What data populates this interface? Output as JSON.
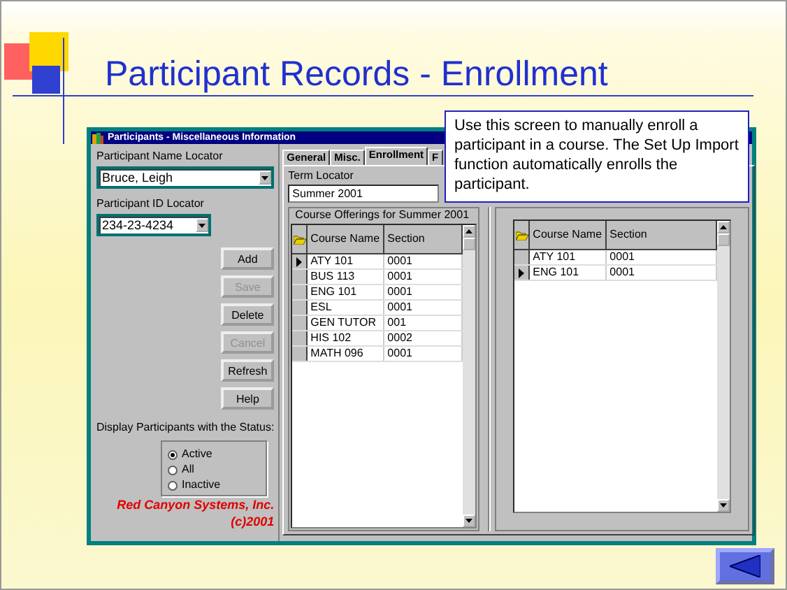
{
  "slide": {
    "title": "Participant Records - Enrollment"
  },
  "window": {
    "title": "Participants - Miscellaneous Information"
  },
  "name_locator": {
    "label": "Participant Name Locator",
    "value": "Bruce, Leigh"
  },
  "id_locator": {
    "label": "Participant ID Locator",
    "value": "234-23-4234"
  },
  "buttons": [
    {
      "label": "Add",
      "disabled": false
    },
    {
      "label": "Save",
      "disabled": true
    },
    {
      "label": "Delete",
      "disabled": false
    },
    {
      "label": "Cancel",
      "disabled": true
    },
    {
      "label": "Refresh",
      "disabled": false
    },
    {
      "label": "Help",
      "disabled": false
    }
  ],
  "status_group": {
    "label": "Display Participants with the Status:",
    "options": [
      {
        "label": "Active",
        "selected": true
      },
      {
        "label": "All",
        "selected": false
      },
      {
        "label": "Inactive",
        "selected": false
      }
    ]
  },
  "copyright": [
    "Red Canyon Systems, Inc.",
    "(c)2001"
  ],
  "tabs": [
    {
      "label": "General",
      "selected": false
    },
    {
      "label": "Misc.",
      "selected": false
    },
    {
      "label": "Enrollment",
      "selected": true
    },
    {
      "label": "F",
      "selected": false
    }
  ],
  "term_locator": {
    "label": "Term Locator",
    "value": "Summer 2001"
  },
  "offerings": {
    "title": "Course Offerings for Summer 2001",
    "columns": [
      "Course Name",
      "Section"
    ],
    "rows": [
      {
        "cells": [
          "ATY 101",
          "0001"
        ],
        "current": true
      },
      {
        "cells": [
          "BUS 113",
          "0001"
        ],
        "current": false
      },
      {
        "cells": [
          "ENG 101",
          "0001"
        ],
        "current": false
      },
      {
        "cells": [
          "ESL",
          "0001"
        ],
        "current": false
      },
      {
        "cells": [
          "GEN TUTOR",
          "001"
        ],
        "current": false
      },
      {
        "cells": [
          "HIS 102",
          "0002"
        ],
        "current": false
      },
      {
        "cells": [
          "MATH 096",
          "0001"
        ],
        "current": false
      }
    ]
  },
  "enrolled": {
    "columns": [
      "Course Name",
      "Section"
    ],
    "rows": [
      {
        "cells": [
          "ATY 101",
          "0001"
        ],
        "current": false
      },
      {
        "cells": [
          "ENG 101",
          "0001"
        ],
        "current": true
      }
    ]
  },
  "callout": "Use this screen to manually enroll a participant in a course.  The Set Up Import function automatically enrolls the participant."
}
